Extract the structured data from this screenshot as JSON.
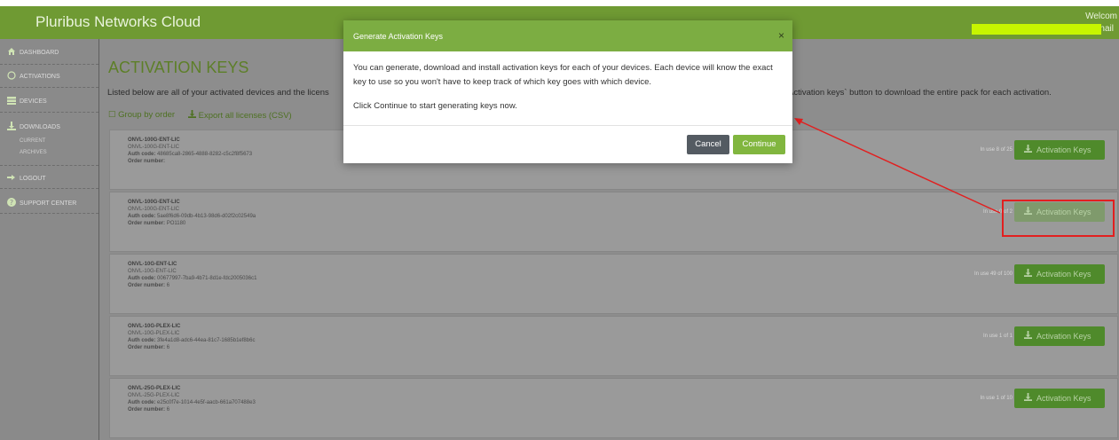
{
  "header": {
    "brand": "Pluribus Networks Cloud",
    "welcome": "Welcom",
    "user_suffix": "nail"
  },
  "sidebar": {
    "items": [
      {
        "label": "DASHBOARD",
        "icon": "home-icon"
      },
      {
        "label": "ACTIVATIONS",
        "icon": "circle-icon"
      },
      {
        "label": "DEVICES",
        "icon": "devices-icon"
      },
      {
        "label": "DOWNLOADS",
        "icon": "download-icon"
      },
      {
        "label": "LOGOUT",
        "icon": "logout-icon"
      },
      {
        "label": "SUPPORT CENTER",
        "icon": "question-icon"
      }
    ],
    "downloads_sub": [
      "CURRENT",
      "ARCHIVES"
    ]
  },
  "page": {
    "title": "ACTIVATION KEYS",
    "intro_left": "Listed below are all of your activated devices and the licens",
    "intro_right": "Activation keys` button to download the entire pack for each activation.",
    "group_by_order": "Group by order",
    "export_all": "Export all licenses (CSV)"
  },
  "activations": [
    {
      "name": "ONVL-100G-ENT-LIC",
      "sku": "ONVL-100G-ENT-LIC",
      "auth_code": "48685ca8-2865-4888-8282-c5c2f8f5673",
      "order": "",
      "in_use": "In use 8 of 25",
      "button": "Activation Keys"
    },
    {
      "name": "ONVL-100G-ENT-LIC",
      "sku": "ONVL-100G-ENT-LIC",
      "auth_code": "5ae8f6d6-09db-4b13-98d6-d02f2c02549a",
      "order": "PO1180",
      "in_use": "In use 0 of 2",
      "button": "Activation Keys"
    },
    {
      "name": "ONVL-10G-ENT-LIC",
      "sku": "ONVL-10G-ENT-LIC",
      "auth_code": "00677997-7ba9-4b71-8d1e-fdc2005036c1",
      "order": "6",
      "in_use": "In use 49 of 100",
      "button": "Activation Keys"
    },
    {
      "name": "ONVL-10G-PLEX-LIC",
      "sku": "ONVL-10G-PLEX-LIC",
      "auth_code": "3fe4a1d8-adc6-44ea-81c7-1685b1ef8b6c",
      "order": "6",
      "in_use": "In use 1 of 1",
      "button": "Activation Keys"
    },
    {
      "name": "ONVL-25G-PLEX-LIC",
      "sku": "ONVL-25G-PLEX-LIC",
      "auth_code": "e25c0f7e-1014-4e5f-aacb-661a707488e3",
      "order": "6",
      "in_use": "In use 1 of 10",
      "button": "Activation Keys"
    }
  ],
  "labels": {
    "auth_code": "Auth code:",
    "order_number": "Order number:"
  },
  "modal": {
    "title": "Generate Activation Keys",
    "close": "×",
    "body_line1": "You can generate, download and install activation keys for each of your devices. Each device will know the exact key to use so you won't have to keep track of which key goes with which device.",
    "body_line2": "Click Continue to start generating keys now.",
    "cancel": "Cancel",
    "continue": "Continue"
  },
  "colors": {
    "brand_green": "#6f9a33",
    "modal_header": "#7cad42",
    "annotation_red": "#e21f1f",
    "redaction": "#c7f500"
  }
}
